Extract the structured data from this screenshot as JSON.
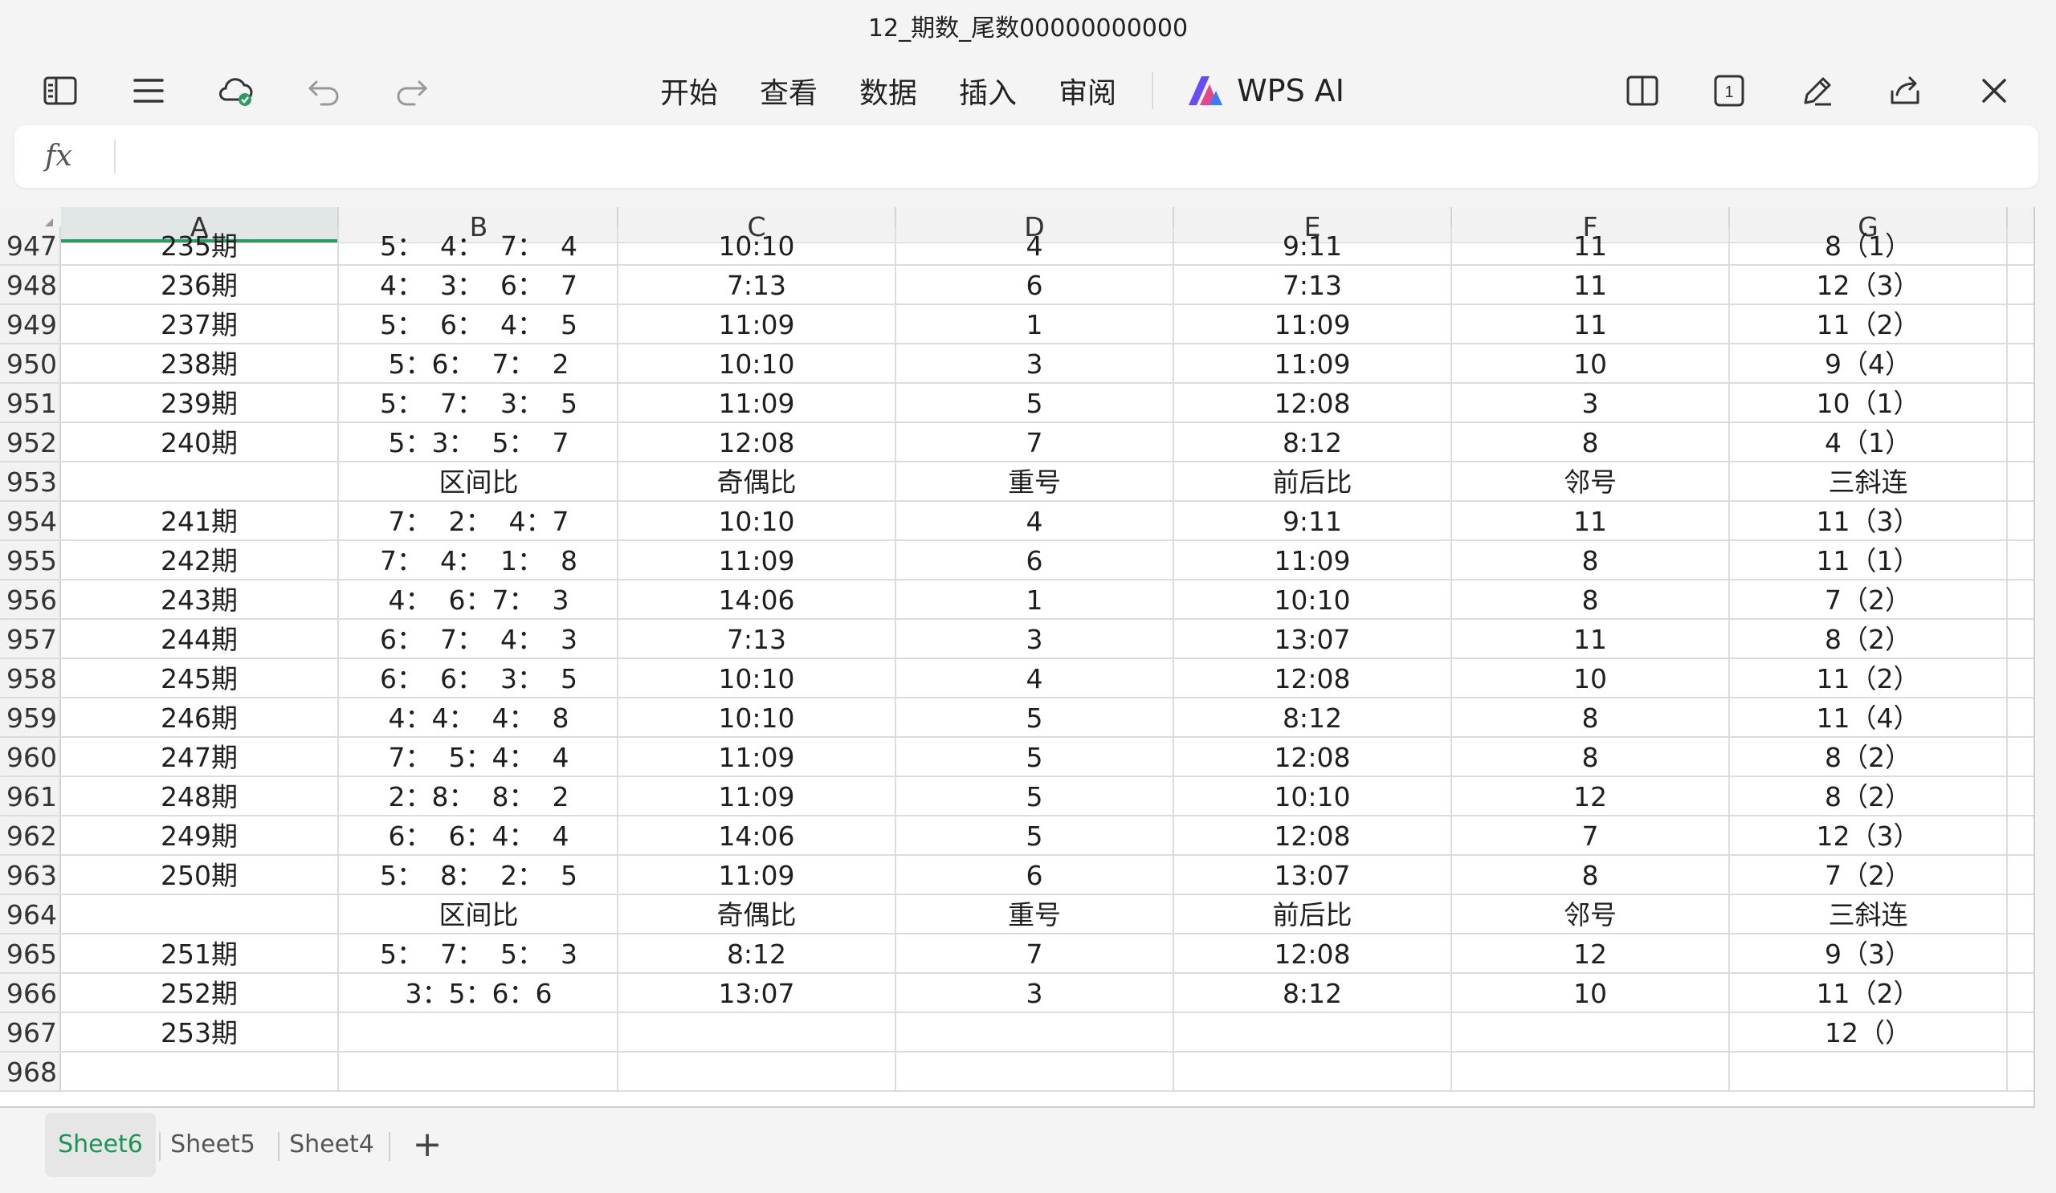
{
  "app": {
    "title": "12_期数_尾数00000000000"
  },
  "toolbar": {
    "icons": [
      "sidebar-toggle-icon",
      "menu-icon",
      "cloud-sync-icon",
      "undo-icon",
      "redo-icon"
    ],
    "menu": [
      "开始",
      "查看",
      "数据",
      "插入",
      "审阅"
    ],
    "wps_ai": "WPS AI",
    "right_icons": [
      "split-view-icon",
      "page-count-icon",
      "pen-icon",
      "share-icon",
      "close-icon"
    ],
    "page_count": "1",
    "accent": "#2e9a63"
  },
  "formula_bar": {
    "fx": "fx",
    "value": ""
  },
  "sheet": {
    "columns": [
      "A",
      "B",
      "C",
      "D",
      "E",
      "F",
      "G"
    ],
    "selected_column": "A",
    "rows": [
      {
        "n": "947",
        "a": "235期",
        "b": "5：  4：  7：  4",
        "c": "10:10",
        "d": "4",
        "e": "9:11",
        "f": "11",
        "g": "8（1）"
      },
      {
        "n": "948",
        "a": "236期",
        "b": "4：  3：  6：  7",
        "c": "7:13",
        "d": "6",
        "e": "7:13",
        "f": "11",
        "g": "12（3）"
      },
      {
        "n": "949",
        "a": "237期",
        "b": "5：  6：  4：  5",
        "c": "11:09",
        "d": "1",
        "e": "11:09",
        "f": "11",
        "g": "11（2）"
      },
      {
        "n": "950",
        "a": "238期",
        "b": "5：6：  7：  2",
        "c": "10:10",
        "d": "3",
        "e": "11:09",
        "f": "10",
        "g": "9（4）"
      },
      {
        "n": "951",
        "a": "239期",
        "b": "5：  7：  3：  5",
        "c": "11:09",
        "d": "5",
        "e": "12:08",
        "f": "3",
        "g": "10（1）"
      },
      {
        "n": "952",
        "a": "240期",
        "b": "5：3：  5：  7",
        "c": "12:08",
        "d": "7",
        "e": "8:12",
        "f": "8",
        "g": "4（1）"
      },
      {
        "n": "953",
        "a": "",
        "b": "区间比",
        "c": "奇偶比",
        "d": "重号",
        "e": "前后比",
        "f": "邻号",
        "g": "三斜连"
      },
      {
        "n": "954",
        "a": "241期",
        "b": "7：  2：  4：7",
        "c": "10:10",
        "d": "4",
        "e": "9:11",
        "f": "11",
        "g": "11（3）"
      },
      {
        "n": "955",
        "a": "242期",
        "b": "7：  4：  1：  8",
        "c": "11:09",
        "d": "6",
        "e": "11:09",
        "f": "8",
        "g": "11（1）"
      },
      {
        "n": "956",
        "a": "243期",
        "b": "4：  6：7：  3",
        "c": "14:06",
        "d": "1",
        "e": "10:10",
        "f": "8",
        "g": "7（2）"
      },
      {
        "n": "957",
        "a": "244期",
        "b": "6：  7：  4：  3",
        "c": "7:13",
        "d": "3",
        "e": "13:07",
        "f": "11",
        "g": "8（2）"
      },
      {
        "n": "958",
        "a": "245期",
        "b": "6：  6：  3：  5",
        "c": "10:10",
        "d": "4",
        "e": "12:08",
        "f": "10",
        "g": "11（2）"
      },
      {
        "n": "959",
        "a": "246期",
        "b": "4：4：  4：  8",
        "c": "10:10",
        "d": "5",
        "e": "8:12",
        "f": "8",
        "g": "11（4）"
      },
      {
        "n": "960",
        "a": "247期",
        "b": "7：  5：4：  4",
        "c": "11:09",
        "d": "5",
        "e": "12:08",
        "f": "8",
        "g": "8（2）"
      },
      {
        "n": "961",
        "a": "248期",
        "b": "2：8：  8：  2",
        "c": "11:09",
        "d": "5",
        "e": "10:10",
        "f": "12",
        "g": "8（2）"
      },
      {
        "n": "962",
        "a": "249期",
        "b": "6：  6：4：  4",
        "c": "14:06",
        "d": "5",
        "e": "12:08",
        "f": "7",
        "g": "12（3）"
      },
      {
        "n": "963",
        "a": "250期",
        "b": "5：  8：  2：  5",
        "c": "11:09",
        "d": "6",
        "e": "13:07",
        "f": "8",
        "g": "7（2）"
      },
      {
        "n": "964",
        "a": "",
        "b": "区间比",
        "c": "奇偶比",
        "d": "重号",
        "e": "前后比",
        "f": "邻号",
        "g": "三斜连"
      },
      {
        "n": "965",
        "a": "251期",
        "b": "5：  7：  5：  3",
        "c": "8:12",
        "d": "7",
        "e": "12:08",
        "f": "12",
        "g": "9（3）"
      },
      {
        "n": "966",
        "a": "252期",
        "b": "3：5：6：6",
        "c": "13:07",
        "d": "3",
        "e": "8:12",
        "f": "10",
        "g": "11（2）"
      },
      {
        "n": "967",
        "a": "253期",
        "b": "",
        "c": "",
        "d": "",
        "e": "",
        "f": "",
        "g": "12（）"
      },
      {
        "n": "968",
        "a": "",
        "b": "",
        "c": "",
        "d": "",
        "e": "",
        "f": "",
        "g": ""
      }
    ]
  },
  "sheet_tabs": [
    {
      "label": "Sheet6",
      "active": true
    },
    {
      "label": "Sheet5",
      "active": false
    },
    {
      "label": "Sheet4",
      "active": false
    }
  ],
  "add_sheet": "+"
}
